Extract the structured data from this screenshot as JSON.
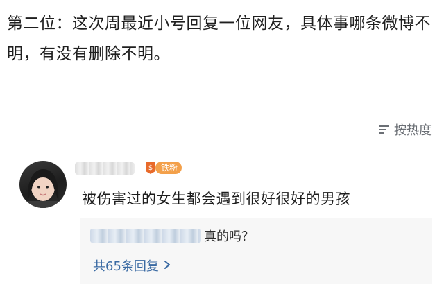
{
  "article": {
    "text": "第二位：这次周最近小号回复一位网友，具体事哪条微博不明，有没有删除不明。"
  },
  "sort": {
    "icon": "sort-icon",
    "label": "按热度"
  },
  "comment": {
    "avatar": "avatar",
    "username_redacted": true,
    "fan_badge": "铁粉",
    "text": "被伤害过的女生都会遇到很好很好的男孩",
    "reply": {
      "text": "真的吗？",
      "more_label": "共65条回复",
      "more_icon": "chevron-right-icon"
    }
  },
  "colors": {
    "link": "#3a6aa3",
    "badge": "#f3a04a",
    "reply_bg": "#f7f7f7",
    "muted": "#6b6f75"
  }
}
